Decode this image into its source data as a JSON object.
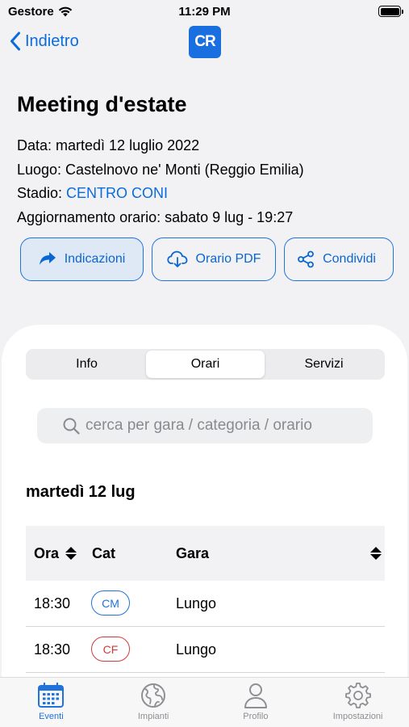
{
  "status_bar": {
    "carrier": "Gestore",
    "time": "11:29 PM"
  },
  "nav": {
    "back_label": "Indietro",
    "logo_text": "CR"
  },
  "event": {
    "title": "Meeting d'estate",
    "date_line": "Data: martedì 12 luglio 2022",
    "place_line": "Luogo: Castelnovo ne' Monti (Reggio Emilia)",
    "stadium_label": "Stadio: ",
    "stadium_link": "CENTRO CONI",
    "update_line": "Aggiornamento orario: sabato 9 lug - 19:27"
  },
  "actions": {
    "directions": "Indicazioni",
    "pdf": "Orario PDF",
    "share": "Condividi"
  },
  "segments": {
    "info": "Info",
    "schedule": "Orari",
    "services": "Servizi",
    "active": "Orari"
  },
  "search": {
    "placeholder": "cerca per gara / categoria / orario"
  },
  "schedule": {
    "day": "martedì 12 lug",
    "headers": {
      "time": "Ora",
      "category": "Cat",
      "event": "Gara"
    },
    "rows": [
      {
        "time": "18:30",
        "category": "CM",
        "event": "Lungo",
        "category_color": "#1f73db"
      },
      {
        "time": "18:30",
        "category": "CF",
        "event": "Lungo",
        "category_color": "#d23a3a"
      }
    ]
  },
  "tab_bar": {
    "events": "Eventi",
    "venues": "Impianti",
    "profile": "Profilo",
    "settings": "Impostazioni",
    "active": "Eventi"
  },
  "colors": {
    "accent": "#1f73db",
    "link": "#0a6cdc",
    "female": "#d23a3a",
    "background": "#f2f2f4"
  }
}
